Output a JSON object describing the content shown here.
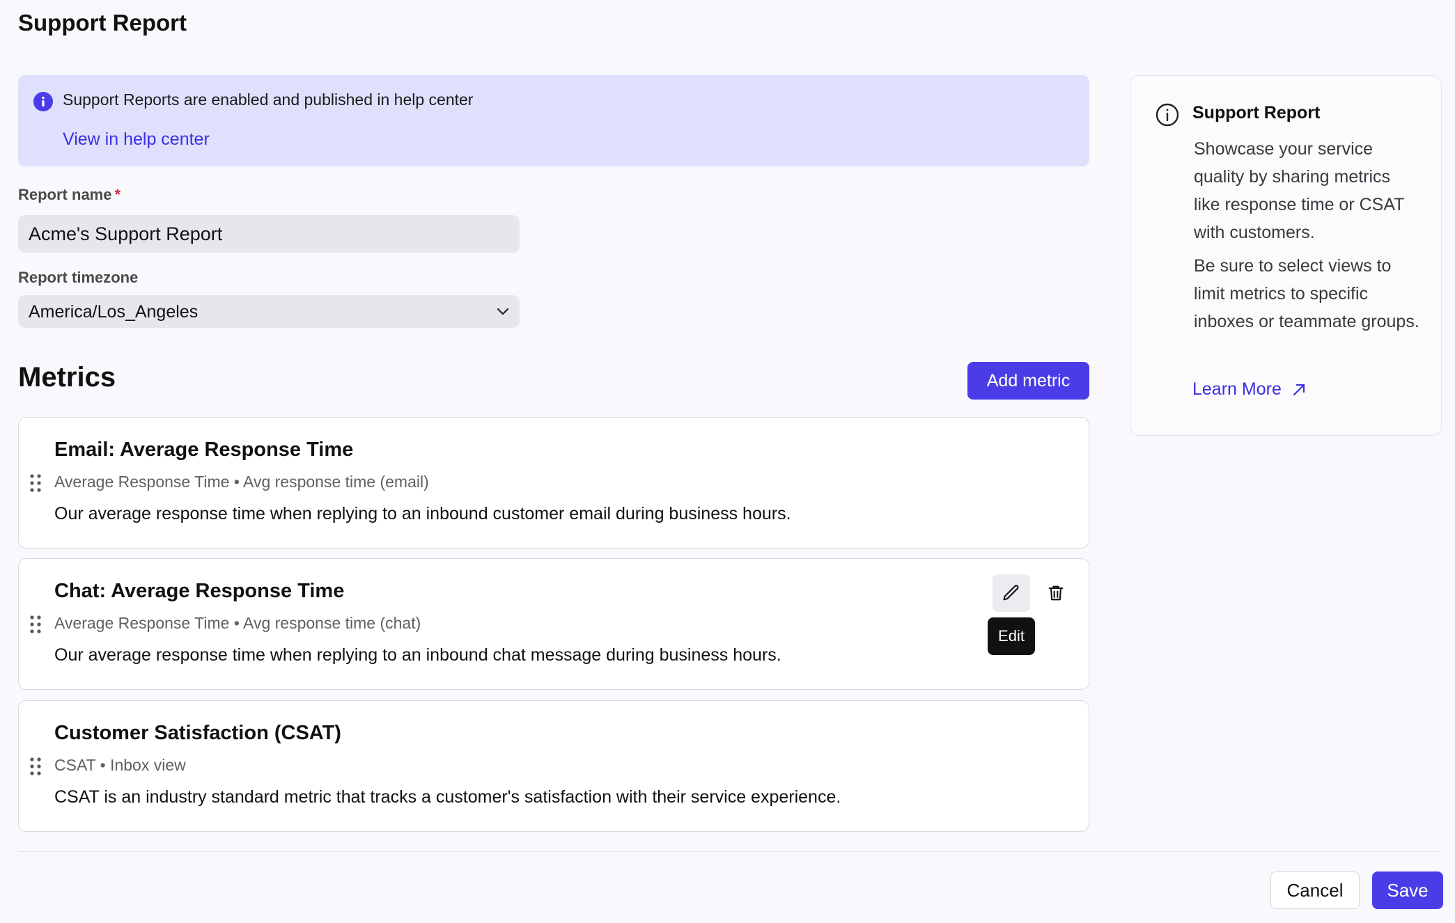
{
  "page": {
    "title": "Support Report"
  },
  "banner": {
    "text": "Support Reports are enabled and published in help center",
    "link": "View in help center",
    "icon": "info-icon"
  },
  "form": {
    "report_name_label": "Report name",
    "required_marker": "*",
    "report_name_value": "Acme's Support Report",
    "timezone_label": "Report timezone",
    "timezone_value": "America/Los_Angeles"
  },
  "metrics": {
    "title": "Metrics",
    "add_button": "Add metric",
    "items": [
      {
        "title": "Email: Average Response Time",
        "metric": "Average Response Time",
        "separator": "•",
        "view": "Avg response time (email)",
        "description": "Our average response time when replying to an inbound customer email during business hours."
      },
      {
        "title": "Chat: Average Response Time",
        "metric": "Average Response Time",
        "separator": "•",
        "view": "Avg response time (chat)",
        "description": "Our average response time when replying to an inbound chat message during business hours."
      },
      {
        "title": "Customer Satisfaction (CSAT)",
        "metric": "CSAT",
        "separator": "•",
        "view": "Inbox view",
        "description": "CSAT is an industry standard metric that tracks a customer's satisfaction with their service experience."
      }
    ],
    "edit_tooltip": "Edit"
  },
  "side_panel": {
    "title": "Support Report",
    "paragraph1": "Showcase your service quality by sharing metrics like response time or CSAT with customers.",
    "paragraph2": "Be sure to select views to limit metrics to specific inboxes or teammate groups.",
    "learn_more": "Learn More"
  },
  "footer": {
    "cancel": "Cancel",
    "save": "Save"
  },
  "colors": {
    "accent": "#4a3de8",
    "banner_bg": "#dfe0fc",
    "required": "#d6243a"
  }
}
